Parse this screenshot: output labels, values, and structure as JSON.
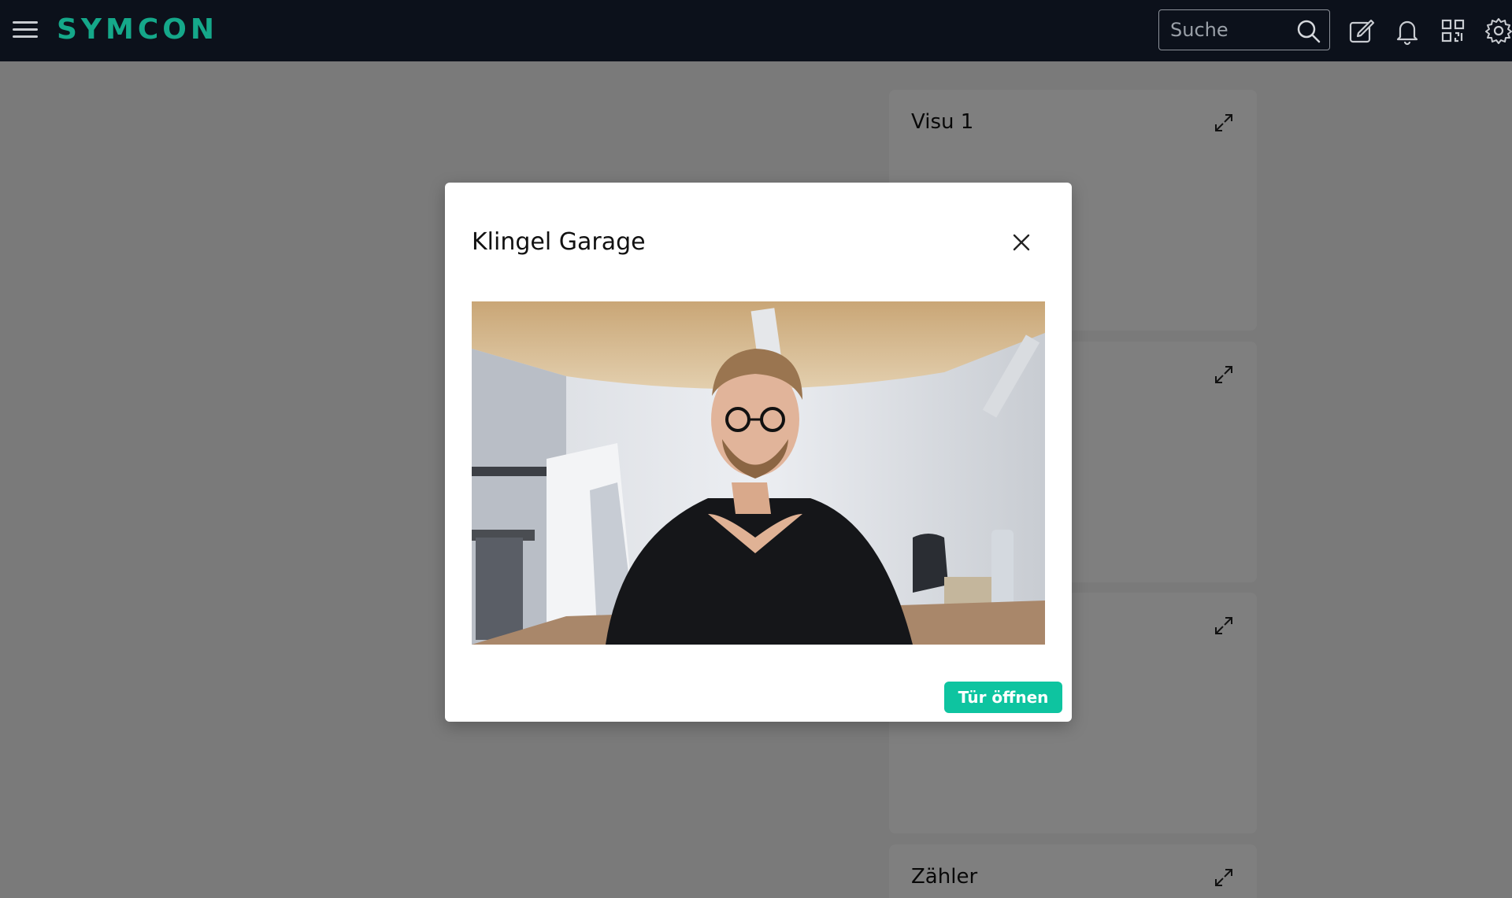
{
  "header": {
    "logo_text": "SYMCON",
    "search_placeholder": "Suche"
  },
  "cards": [
    {
      "title": "Visu 1"
    },
    {
      "title": ""
    },
    {
      "title": ""
    },
    {
      "title": "Zähler"
    }
  ],
  "modal": {
    "title": "Klingel Garage",
    "open_button_label": "Tür öffnen"
  },
  "colors": {
    "topbar_bg": "#0c111b",
    "brand": "#15a88a",
    "accent_button": "#0ec4a0"
  },
  "icons": [
    "menu-icon",
    "search-icon",
    "edit-icon",
    "bell-icon",
    "qr-code-icon",
    "gear-icon",
    "expand-icon",
    "close-icon"
  ]
}
